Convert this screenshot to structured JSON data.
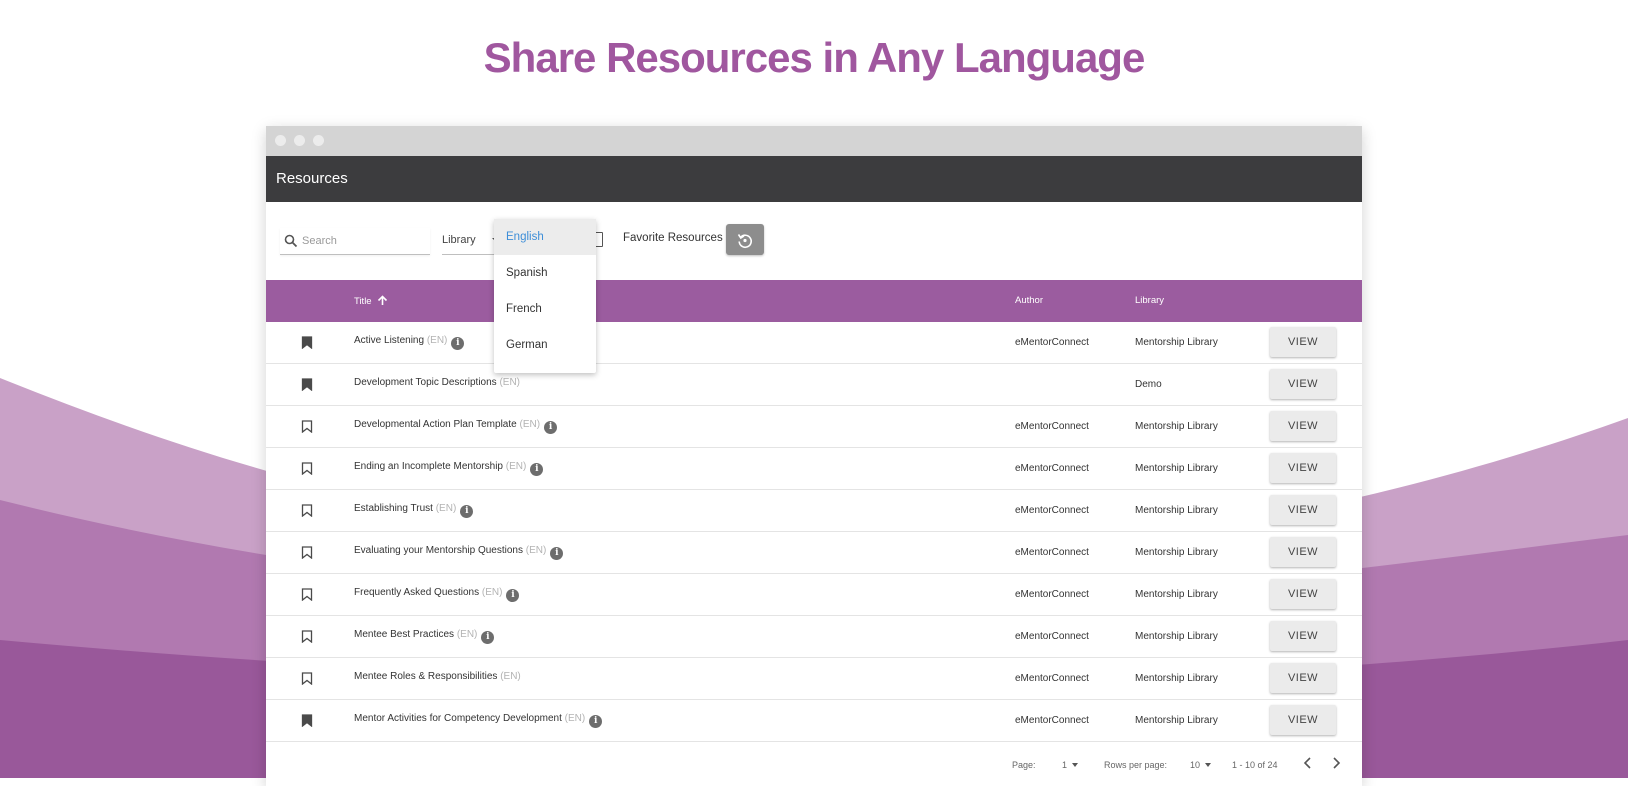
{
  "headline": "Share Resources in Any Language",
  "colors": {
    "accent_purple": "#9b5c9f",
    "headline_purple": "#a0579f",
    "appbar_dark": "#3c3c3e",
    "link_blue": "#3d8ed8"
  },
  "app": {
    "title": "Resources"
  },
  "toolbar": {
    "search_placeholder": "Search",
    "library_label": "Library",
    "favorite_label": "Favorite Resources",
    "reset_icon": "reset-icon"
  },
  "language_menu": {
    "selected": "English",
    "options": [
      "English",
      "Spanish",
      "French",
      "German"
    ]
  },
  "table": {
    "columns": {
      "title": "Title",
      "author": "Author",
      "library": "Library"
    },
    "sort": "ascending",
    "view_label": "VIEW",
    "rows": [
      {
        "title": "Active Listening",
        "lang": "(EN)",
        "info": true,
        "author": "eMentorConnect",
        "library": "Mentorship Library",
        "bookmarked": true
      },
      {
        "title": "Development Topic Descriptions",
        "lang": "(EN)",
        "info": false,
        "author": "",
        "library": "Demo",
        "bookmarked": true
      },
      {
        "title": "Developmental Action Plan Template",
        "lang": "(EN)",
        "info": true,
        "author": "eMentorConnect",
        "library": "Mentorship Library",
        "bookmarked": false
      },
      {
        "title": "Ending an Incomplete Mentorship",
        "lang": "(EN)",
        "info": true,
        "author": "eMentorConnect",
        "library": "Mentorship Library",
        "bookmarked": false
      },
      {
        "title": "Establishing Trust",
        "lang": "(EN)",
        "info": true,
        "author": "eMentorConnect",
        "library": "Mentorship Library",
        "bookmarked": false
      },
      {
        "title": "Evaluating your Mentorship Questions",
        "lang": "(EN)",
        "info": true,
        "author": "eMentorConnect",
        "library": "Mentorship Library",
        "bookmarked": false
      },
      {
        "title": "Frequently Asked Questions",
        "lang": "(EN)",
        "info": true,
        "author": "eMentorConnect",
        "library": "Mentorship Library",
        "bookmarked": false
      },
      {
        "title": "Mentee Best Practices",
        "lang": "(EN)",
        "info": true,
        "author": "eMentorConnect",
        "library": "Mentorship Library",
        "bookmarked": false
      },
      {
        "title": "Mentee Roles & Responsibilities",
        "lang": "(EN)",
        "info": false,
        "author": "eMentorConnect",
        "library": "Mentorship Library",
        "bookmarked": false
      },
      {
        "title": "Mentor Activities for Competency Development",
        "lang": "(EN)",
        "info": true,
        "author": "eMentorConnect",
        "library": "Mentorship Library",
        "bookmarked": true
      }
    ]
  },
  "pagination": {
    "page_label": "Page:",
    "page_value": "1",
    "rows_label": "Rows per page:",
    "rows_value": "10",
    "range": "1 - 10 of 24"
  }
}
